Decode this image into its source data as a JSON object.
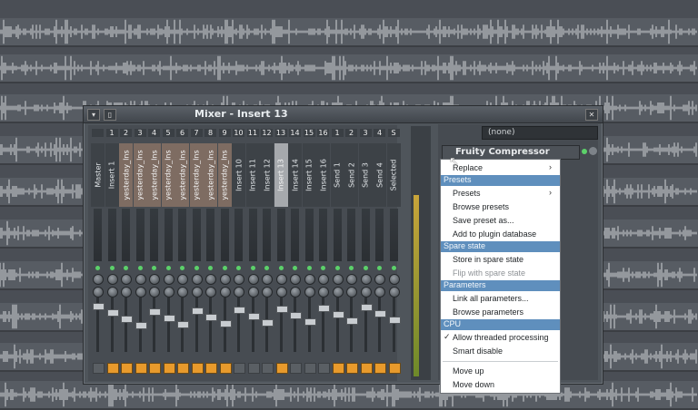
{
  "mixer": {
    "title": "Mixer - Insert 13",
    "preset": "(none)",
    "strips": [
      {
        "num": "",
        "name": "Master",
        "style": "plain"
      },
      {
        "num": "1",
        "name": "Insert 1",
        "style": "plain"
      },
      {
        "num": "2",
        "name": "yesterday_Ins",
        "style": "tan"
      },
      {
        "num": "3",
        "name": "yesterday_Ins",
        "style": "tan"
      },
      {
        "num": "4",
        "name": "yesterday_Ins",
        "style": "tan"
      },
      {
        "num": "5",
        "name": "yesterday_Ins",
        "style": "tan"
      },
      {
        "num": "6",
        "name": "yesterday_Ins",
        "style": "tan"
      },
      {
        "num": "7",
        "name": "yesterday_Ins",
        "style": "tan"
      },
      {
        "num": "8",
        "name": "yesterday_Ins",
        "style": "tan"
      },
      {
        "num": "9",
        "name": "yesterday_Ins",
        "style": "tan"
      },
      {
        "num": "10",
        "name": "Insert 10",
        "style": "plain"
      },
      {
        "num": "11",
        "name": "Insert 11",
        "style": "plain"
      },
      {
        "num": "12",
        "name": "Insert 12",
        "style": "plain"
      },
      {
        "num": "13",
        "name": "Insert 13",
        "style": "sel"
      },
      {
        "num": "14",
        "name": "Insert 14",
        "style": "plain"
      },
      {
        "num": "15",
        "name": "Insert 15",
        "style": "plain"
      },
      {
        "num": "16",
        "name": "Insert 16",
        "style": "plain"
      },
      {
        "num": "1",
        "name": "Send 1",
        "style": "plain"
      },
      {
        "num": "2",
        "name": "Send 2",
        "style": "plain"
      },
      {
        "num": "3",
        "name": "Send 3",
        "style": "plain"
      },
      {
        "num": "4",
        "name": "Send 4",
        "style": "plain"
      },
      {
        "num": "S",
        "name": "Selected",
        "style": "plain"
      }
    ],
    "slots": [
      {
        "name": "Fruity Compressor"
      }
    ]
  },
  "context_menu": {
    "items": [
      {
        "type": "item",
        "label": "Replace",
        "submenu": true
      },
      {
        "type": "header",
        "label": "Presets"
      },
      {
        "type": "item",
        "label": "Presets",
        "submenu": true
      },
      {
        "type": "item",
        "label": "Browse presets"
      },
      {
        "type": "item",
        "label": "Save preset as..."
      },
      {
        "type": "item",
        "label": "Add to plugin database"
      },
      {
        "type": "header",
        "label": "Spare state"
      },
      {
        "type": "item",
        "label": "Store in spare state"
      },
      {
        "type": "item",
        "label": "Flip with spare state",
        "disabled": true
      },
      {
        "type": "header",
        "label": "Parameters"
      },
      {
        "type": "item",
        "label": "Link all parameters..."
      },
      {
        "type": "item",
        "label": "Browse parameters"
      },
      {
        "type": "header",
        "label": "CPU"
      },
      {
        "type": "item",
        "label": "Allow threaded processing",
        "checked": true
      },
      {
        "type": "item",
        "label": "Smart disable"
      },
      {
        "type": "sep"
      },
      {
        "type": "item",
        "label": "Move up"
      },
      {
        "type": "item",
        "label": "Move down"
      }
    ]
  },
  "colors": {
    "accent": "#e89a2c",
    "menu_header": "#5f8fbd",
    "led": "#5cd16a"
  }
}
